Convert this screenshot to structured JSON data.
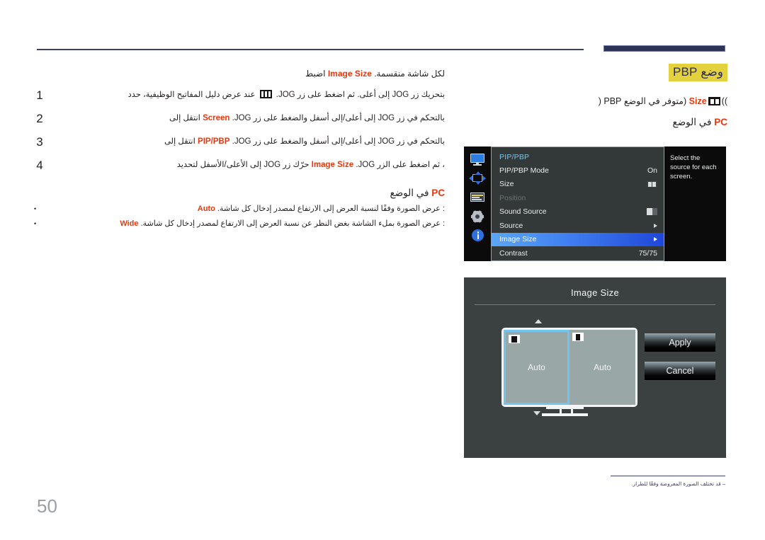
{
  "page": {
    "number": "50",
    "footer_note": "‒ قد تختلف الصورة المعروضة وفقًا للطراز."
  },
  "right_column": {
    "heading": "وضع PBP",
    "availability_prefix": "(متوفر في الوضع PBP (",
    "availability_en": "Size",
    "availability_suffix": "))",
    "mode_label_ar": "في الوضع",
    "mode_label_en": "PC"
  },
  "left_column": {
    "intro_pre": "اضبط",
    "intro_en": "Image Size",
    "intro_post": "لكل شاشة منقسمة.",
    "steps": [
      {
        "num": "1",
        "pre": "عند عرض دليل المفاتيح الوظيفية، حدد",
        "icon": "three-bars-icon",
        "post": "بتحريك زر JOG إلى أعلى. ثم اضغط على زر JOG."
      },
      {
        "num": "2",
        "pre": "انتقل إلى",
        "en": "Screen",
        "post": "بالتحكم في زر JOG إلى أعلى/إلى أسفل والضغط على زر JOG."
      },
      {
        "num": "3",
        "pre": "انتقل إلى",
        "en": "PIP/PBP",
        "post": "بالتحكم في زر JOG إلى أعلى/إلى أسفل والضغط على زر JOG."
      },
      {
        "num": "4",
        "pre": "حرّك زر JOG إلى الأعلى/الأسفل لتحديد",
        "en": "Image Size",
        "post": "، ثم اضغط على الزر JOG."
      }
    ],
    "mode_label_ar": "في الوضع",
    "mode_label_en": "PC",
    "bullets": [
      {
        "en": "Auto",
        "text": ": عرض الصورة وفقًا لنسبة العرض إلى الارتفاع لمصدر إدخال كل شاشة."
      },
      {
        "en": "Wide",
        "text": ": عرض الصورة بملء الشاشة بغض النظر عن نسبة العرض إلى الارتفاع لمصدر إدخال كل شاشة."
      }
    ]
  },
  "osd": {
    "menu_title": "PIP/PBP",
    "sidebar_icons": [
      "monitor-icon",
      "pip-pbp-icon",
      "menu-list-icon",
      "gear-icon",
      "info-icon"
    ],
    "rows": [
      {
        "label": "PIP/PBP Mode",
        "value": "On",
        "value_type": "text",
        "state": "normal"
      },
      {
        "label": "Size",
        "value": "",
        "value_type": "split-icon",
        "state": "normal"
      },
      {
        "label": "Position",
        "value": "",
        "value_type": "none",
        "state": "disabled"
      },
      {
        "label": "Sound Source",
        "value": "",
        "value_type": "sound-icon",
        "state": "normal"
      },
      {
        "label": "Source",
        "value": "",
        "value_type": "arrow",
        "state": "normal"
      },
      {
        "label": "Image Size",
        "value": "",
        "value_type": "arrow",
        "state": "selected"
      },
      {
        "label": "Contrast",
        "value": "75/75",
        "value_type": "text",
        "state": "normal"
      }
    ],
    "tooltip": "Select the source for each screen."
  },
  "dialog": {
    "title": "Image Size",
    "left_pane_label": "Auto",
    "right_pane_label": "Auto",
    "apply_label": "Apply",
    "cancel_label": "Cancel"
  },
  "colors": {
    "accent_red": "#e8380d",
    "highlight_yellow": "#e3d13e",
    "navy": "#3b4263",
    "osd_blue": "#2f6fe0",
    "pane_highlight": "#72c4ef"
  }
}
